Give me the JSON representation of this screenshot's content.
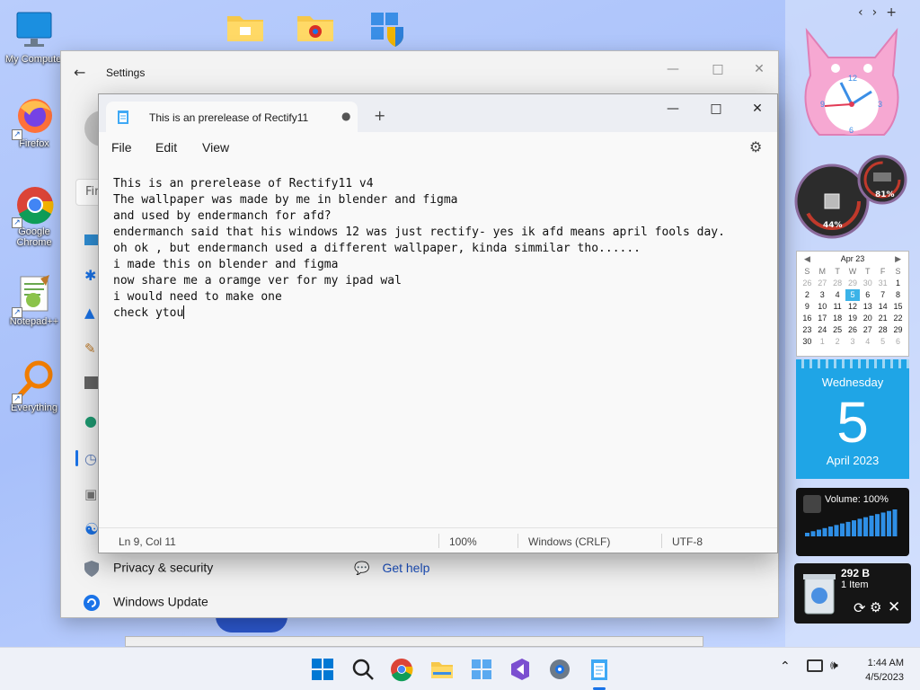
{
  "desktop": {
    "icons": [
      {
        "label": "My Computer"
      },
      {
        "label": "Firefox"
      },
      {
        "label": "Google Chrome"
      },
      {
        "label": "Notepad++"
      },
      {
        "label": "Everything"
      }
    ]
  },
  "settings": {
    "title": "Settings",
    "search_placeholder": "Fin",
    "rows": [
      {
        "label": "Privacy & security"
      },
      {
        "label": "Windows Update"
      }
    ],
    "get_help": "Get help"
  },
  "notepad": {
    "tab_title": "This is an prerelease of Rectify11",
    "menus": [
      "File",
      "Edit",
      "View"
    ],
    "lines": [
      "This is an prerelease of Rectify11 v4",
      "The wallpaper was made by me in blender and figma",
      "and used by endermanch for afd?",
      "endermanch said that his windows 12 was just rectify- yes ik afd means april fools day.",
      "oh ok , but endermanch used a different wallpaper, kinda simmilar tho......",
      "i made this on blender and figma",
      "now share me a oramge ver for my ipad wal",
      "i would need to make one",
      "check ytou"
    ],
    "status": {
      "position": "Ln 9, Col 11",
      "zoom": "100%",
      "line_ending": "Windows (CRLF)",
      "encoding": "UTF-8"
    }
  },
  "widgets": {
    "gauge_left": "44%",
    "gauge_right": "81%",
    "calendar": {
      "month": "Apr 23",
      "headers": [
        "S",
        "M",
        "T",
        "W",
        "T",
        "F",
        "S"
      ],
      "weeks": [
        [
          "26",
          "27",
          "28",
          "29",
          "30",
          "31",
          "1"
        ],
        [
          "2",
          "3",
          "4",
          "5",
          "6",
          "7",
          "8"
        ],
        [
          "9",
          "10",
          "11",
          "12",
          "13",
          "14",
          "15"
        ],
        [
          "16",
          "17",
          "18",
          "19",
          "20",
          "21",
          "22"
        ],
        [
          "23",
          "24",
          "25",
          "26",
          "27",
          "28",
          "29"
        ],
        [
          "30",
          "1",
          "2",
          "3",
          "4",
          "5",
          "6"
        ]
      ]
    },
    "date": {
      "weekday": "Wednesday",
      "day": "5",
      "month_year": "April 2023"
    },
    "volume": {
      "label": "Volume: 100%",
      "level": 1.0
    },
    "recycle": {
      "size": "292 B",
      "items": "1 Item"
    }
  },
  "taskbar": {
    "time": "1:44 AM",
    "date": "4/5/2023"
  }
}
